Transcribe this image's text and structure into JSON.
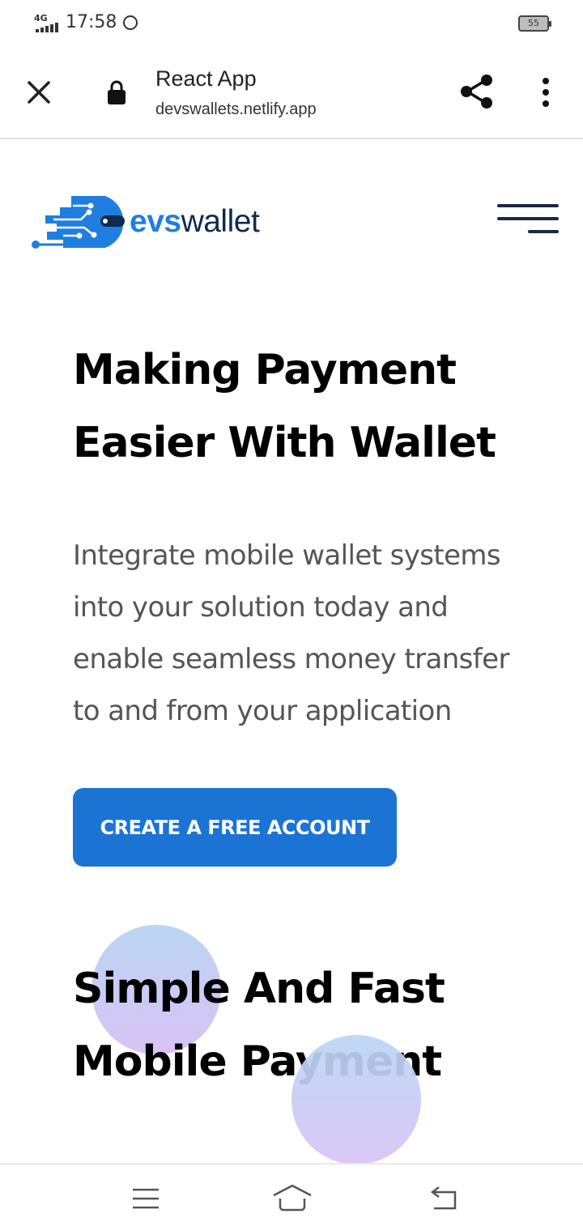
{
  "status_bar": {
    "network": "4G",
    "time": "17:58",
    "battery": "55"
  },
  "browser": {
    "title": "React App",
    "url": "devswallets.netlify.app"
  },
  "logo": {
    "text_colored": "evs",
    "text_dark": "wallet"
  },
  "hero": {
    "title": "Making Payment Easier With Wallet",
    "text": "Integrate mobile wallet systems into your solution today and enable seamless money transfer to and from your application",
    "cta_label": "CREATE A FREE ACCOUNT"
  },
  "section": {
    "title": "Simple And Fast Mobile Payment"
  },
  "colors": {
    "accent": "#1b74d4",
    "logo_blue": "#1f7ee0",
    "logo_dark": "#0d2b4f"
  },
  "icons": {
    "close": "close-icon",
    "lock": "lock-icon",
    "share": "share-icon",
    "more": "more-vert-icon",
    "menu": "hamburger-icon",
    "whatsapp": "whatsapp-icon"
  }
}
